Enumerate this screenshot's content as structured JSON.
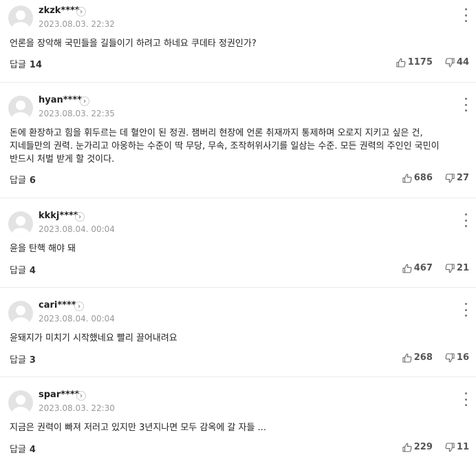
{
  "reply_label": "답글",
  "comments": [
    {
      "author": "zkzk****",
      "date": "2023.08.03. 22:32",
      "text": "언론을 장악해 국민들을 길들이기 하려고 하네요 쿠데타 정권인가?",
      "replies": "14",
      "likes": "1175",
      "dislikes": "44"
    },
    {
      "author": "hyan****",
      "date": "2023.08.03. 22:35",
      "text": "돈에 환장하고 힘을 휘두르는 데 혈안이 된 정권. 잼버리 현장에 언론 취재까지 통제하며 오로지 지키고 싶은 건, 지네들만의 권력. 눈가리고 아웅하는 수준이 딱 무당, 무속, 조작허위사기를 일삼는 수준. 모든 권력의 주인인 국민이 반드시 처벌 받게 할 것이다.",
      "replies": "6",
      "likes": "686",
      "dislikes": "27"
    },
    {
      "author": "kkkj****",
      "date": "2023.08.04. 00:04",
      "text": "윤을 탄핵 해야 돼",
      "replies": "4",
      "likes": "467",
      "dislikes": "21"
    },
    {
      "author": "cari****",
      "date": "2023.08.04. 00:04",
      "text": "윤돼지가 미치기 시작했네요 빨리 끌어내려요",
      "replies": "3",
      "likes": "268",
      "dislikes": "16"
    },
    {
      "author": "spar****",
      "date": "2023.08.03. 22:30",
      "text": "지금은 권력이 빠져 저러고 있지만 3년지나면 모두 감옥에 갈 자들 ...",
      "replies": "4",
      "likes": "229",
      "dislikes": "11"
    }
  ]
}
